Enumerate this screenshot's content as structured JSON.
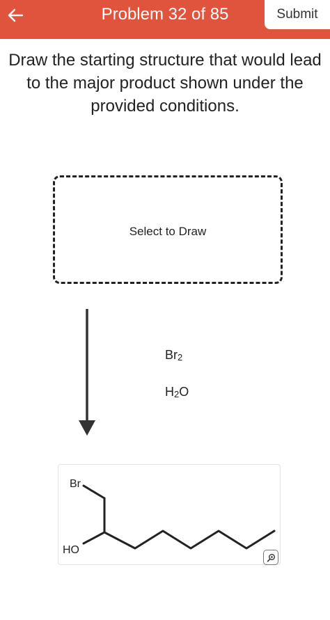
{
  "header": {
    "title": "Problem 32 of 85",
    "submit_label": "Submit",
    "color": "#e0533c"
  },
  "question": {
    "text": "Draw the starting structure that would lead to the major product shown under the provided conditions."
  },
  "draw_area": {
    "label": "Select to Draw"
  },
  "reaction": {
    "reagent_1": {
      "main": "Br",
      "sub": "2"
    },
    "reagent_2": {
      "main_a": "H",
      "sub": "2",
      "main_b": "O"
    }
  },
  "product": {
    "atom_labels": {
      "bromine": "Br",
      "hydroxyl": "HO"
    }
  },
  "icons": [
    "back-arrow-icon",
    "zoom-icon",
    "reaction-arrow-icon"
  ]
}
